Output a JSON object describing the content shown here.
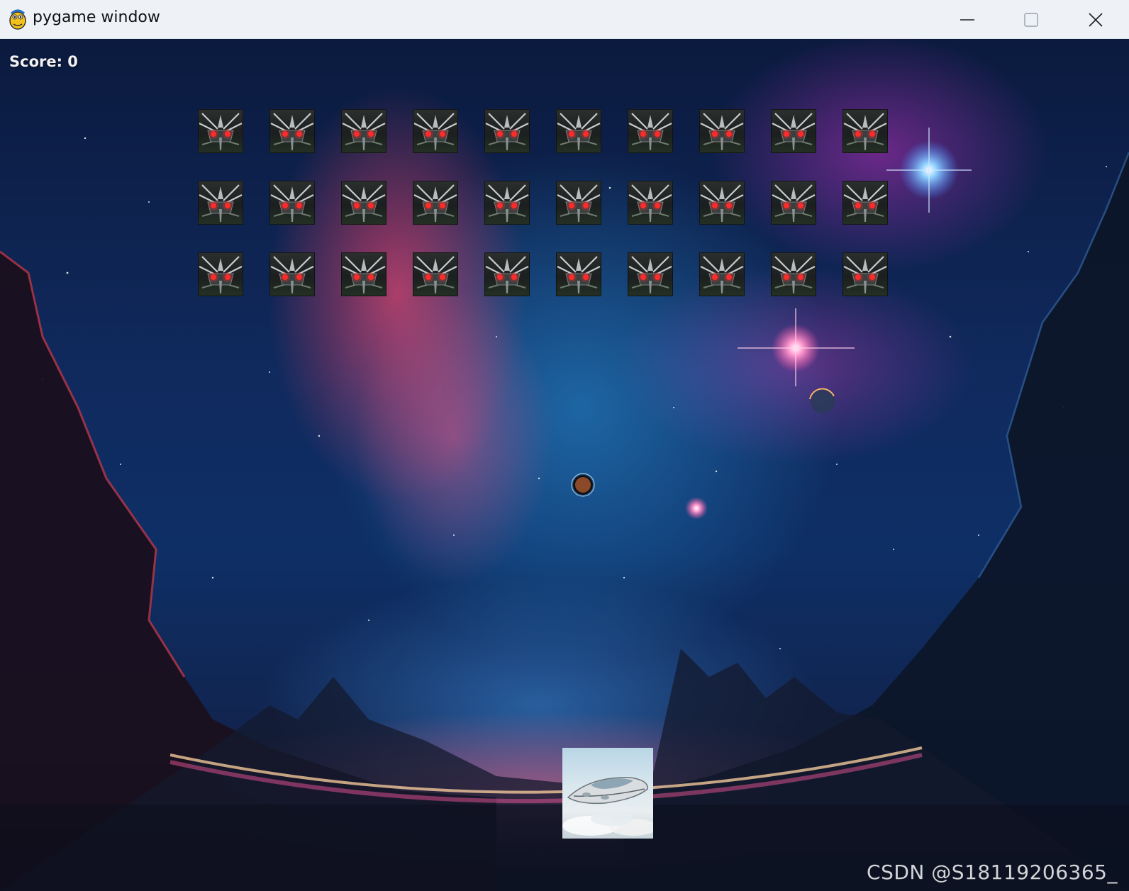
{
  "window": {
    "title": "pygame window",
    "icon": "pygame-snake-icon",
    "controls": {
      "minimize": "minimize-icon",
      "maximize": "maximize-icon",
      "close": "close-icon"
    }
  },
  "game": {
    "score_text": "Score: 0",
    "aliens": {
      "rows": 3,
      "columns": 10,
      "icon": "alien-robot-icon"
    },
    "player": {
      "icon": "spaceship-icon"
    },
    "colors": {
      "alien_eyes": "#ff2a2a",
      "score_text": "#f2f2f2"
    }
  },
  "watermark": "CSDN @S18119206365_"
}
